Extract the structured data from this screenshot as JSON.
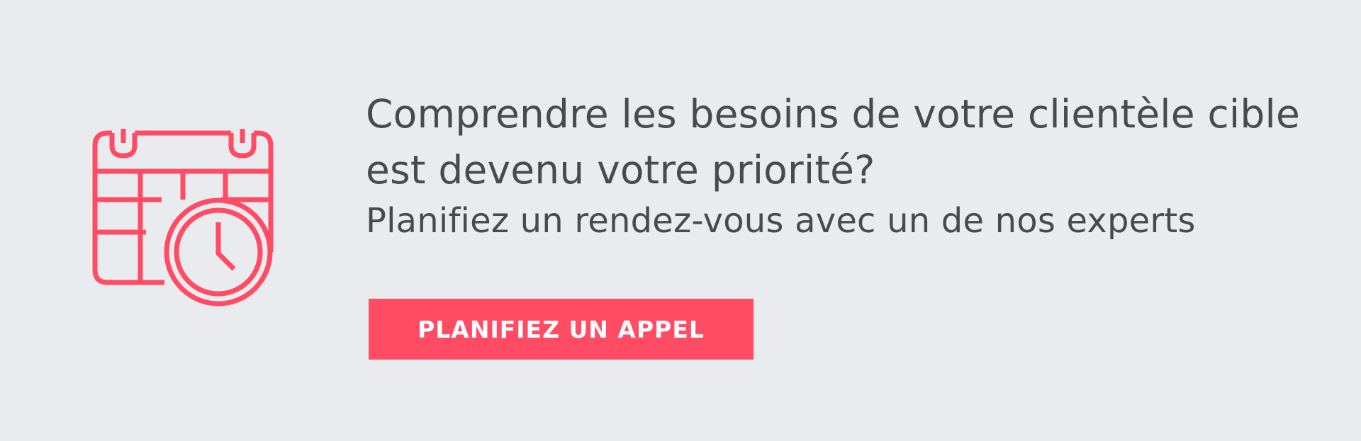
{
  "banner": {
    "headline": "Comprendre les besoins de votre clientèle cible est devenu votre priorité?",
    "subline": "Planifiez un rendez-vous avec un de nos experts",
    "cta_label": "PLANIFIEZ UN APPEL",
    "icon": "calendar-clock-icon"
  },
  "colors": {
    "background": "#e9ebee",
    "accent": "#ff4b63",
    "text": "#4a4a4c",
    "button_text": "#ffffff"
  }
}
